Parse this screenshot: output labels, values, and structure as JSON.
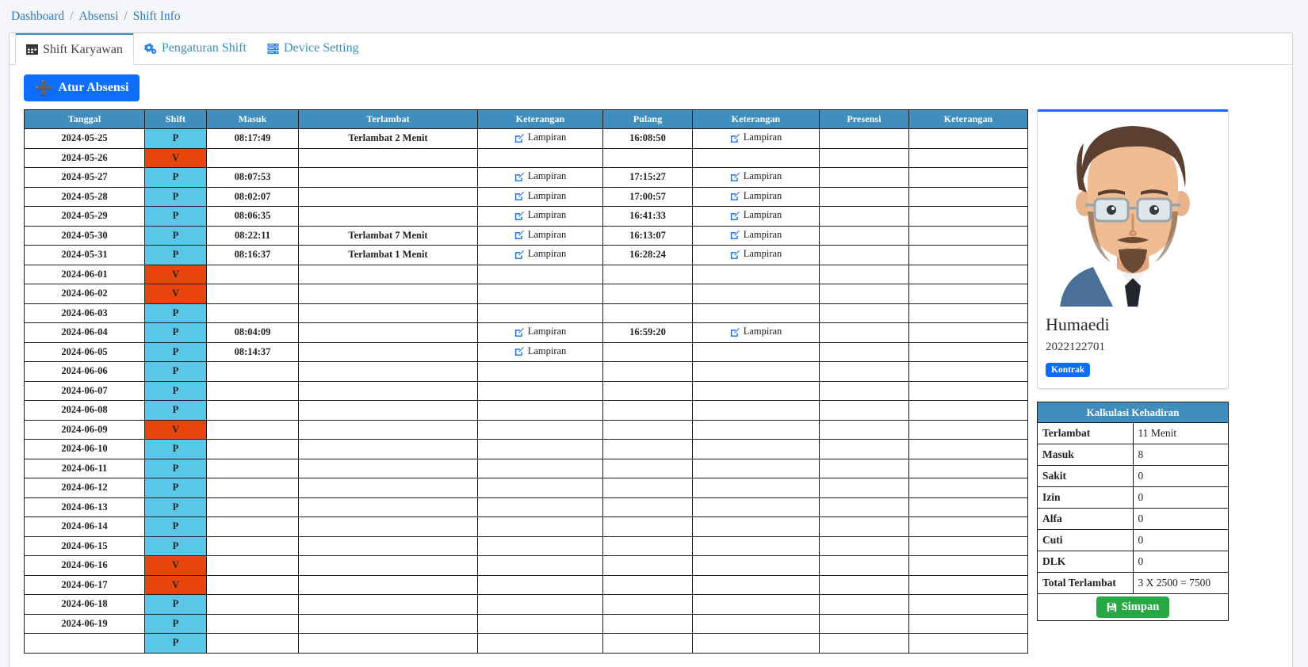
{
  "breadcrumb": {
    "items": [
      {
        "label": "Dashboard",
        "link": true
      },
      {
        "label": "Absensi",
        "link": true
      },
      {
        "label": "Shift Info",
        "link": true
      }
    ],
    "separator": "/"
  },
  "tabs": [
    {
      "label": "Shift Karyawan",
      "icon": "calendar-icon",
      "active": true
    },
    {
      "label": "Pengaturan Shift",
      "icon": "gears-icon",
      "active": false
    },
    {
      "label": "Device Setting",
      "icon": "server-icon",
      "active": false
    }
  ],
  "toolbar": {
    "add_button_label": "Atur Absensi",
    "add_button_icon": "plus-icon"
  },
  "table": {
    "columns": [
      "Tanggal",
      "Shift",
      "Masuk",
      "Terlambat",
      "Keterangan",
      "Pulang",
      "Keterangan",
      "Presensi",
      "Keterangan"
    ],
    "attachment_label": "Lampiran",
    "attachment_icon": "edit-square-icon",
    "rows": [
      {
        "tanggal": "2024-05-25",
        "shift": "P",
        "masuk": "08:17:49",
        "terlambat": "Terlambat 2 Menit",
        "ket1": "Lampiran",
        "pulang": "16:08:50",
        "ket2": "Lampiran",
        "presensi": "",
        "ket3": ""
      },
      {
        "tanggal": "2024-05-26",
        "shift": "V",
        "masuk": "",
        "terlambat": "",
        "ket1": "",
        "pulang": "",
        "ket2": "",
        "presensi": "",
        "ket3": ""
      },
      {
        "tanggal": "2024-05-27",
        "shift": "P",
        "masuk": "08:07:53",
        "terlambat": "",
        "ket1": "Lampiran",
        "pulang": "17:15:27",
        "ket2": "Lampiran",
        "presensi": "",
        "ket3": ""
      },
      {
        "tanggal": "2024-05-28",
        "shift": "P",
        "masuk": "08:02:07",
        "terlambat": "",
        "ket1": "Lampiran",
        "pulang": "17:00:57",
        "ket2": "Lampiran",
        "presensi": "",
        "ket3": ""
      },
      {
        "tanggal": "2024-05-29",
        "shift": "P",
        "masuk": "08:06:35",
        "terlambat": "",
        "ket1": "Lampiran",
        "pulang": "16:41:33",
        "ket2": "Lampiran",
        "presensi": "",
        "ket3": ""
      },
      {
        "tanggal": "2024-05-30",
        "shift": "P",
        "masuk": "08:22:11",
        "terlambat": "Terlambat 7 Menit",
        "ket1": "Lampiran",
        "pulang": "16:13:07",
        "ket2": "Lampiran",
        "presensi": "",
        "ket3": ""
      },
      {
        "tanggal": "2024-05-31",
        "shift": "P",
        "masuk": "08:16:37",
        "terlambat": "Terlambat 1 Menit",
        "ket1": "Lampiran",
        "pulang": "16:28:24",
        "ket2": "Lampiran",
        "presensi": "",
        "ket3": ""
      },
      {
        "tanggal": "2024-06-01",
        "shift": "V",
        "masuk": "",
        "terlambat": "",
        "ket1": "",
        "pulang": "",
        "ket2": "",
        "presensi": "",
        "ket3": ""
      },
      {
        "tanggal": "2024-06-02",
        "shift": "V",
        "masuk": "",
        "terlambat": "",
        "ket1": "",
        "pulang": "",
        "ket2": "",
        "presensi": "",
        "ket3": ""
      },
      {
        "tanggal": "2024-06-03",
        "shift": "P",
        "masuk": "",
        "terlambat": "",
        "ket1": "",
        "pulang": "",
        "ket2": "",
        "presensi": "",
        "ket3": ""
      },
      {
        "tanggal": "2024-06-04",
        "shift": "P",
        "masuk": "08:04:09",
        "terlambat": "",
        "ket1": "Lampiran",
        "pulang": "16:59:20",
        "ket2": "Lampiran",
        "presensi": "",
        "ket3": ""
      },
      {
        "tanggal": "2024-06-05",
        "shift": "P",
        "masuk": "08:14:37",
        "terlambat": "",
        "ket1": "Lampiran",
        "pulang": "",
        "ket2": "",
        "presensi": "",
        "ket3": ""
      },
      {
        "tanggal": "2024-06-06",
        "shift": "P",
        "masuk": "",
        "terlambat": "",
        "ket1": "",
        "pulang": "",
        "ket2": "",
        "presensi": "",
        "ket3": ""
      },
      {
        "tanggal": "2024-06-07",
        "shift": "P",
        "masuk": "",
        "terlambat": "",
        "ket1": "",
        "pulang": "",
        "ket2": "",
        "presensi": "",
        "ket3": ""
      },
      {
        "tanggal": "2024-06-08",
        "shift": "P",
        "masuk": "",
        "terlambat": "",
        "ket1": "",
        "pulang": "",
        "ket2": "",
        "presensi": "",
        "ket3": ""
      },
      {
        "tanggal": "2024-06-09",
        "shift": "V",
        "masuk": "",
        "terlambat": "",
        "ket1": "",
        "pulang": "",
        "ket2": "",
        "presensi": "",
        "ket3": ""
      },
      {
        "tanggal": "2024-06-10",
        "shift": "P",
        "masuk": "",
        "terlambat": "",
        "ket1": "",
        "pulang": "",
        "ket2": "",
        "presensi": "",
        "ket3": ""
      },
      {
        "tanggal": "2024-06-11",
        "shift": "P",
        "masuk": "",
        "terlambat": "",
        "ket1": "",
        "pulang": "",
        "ket2": "",
        "presensi": "",
        "ket3": ""
      },
      {
        "tanggal": "2024-06-12",
        "shift": "P",
        "masuk": "",
        "terlambat": "",
        "ket1": "",
        "pulang": "",
        "ket2": "",
        "presensi": "",
        "ket3": ""
      },
      {
        "tanggal": "2024-06-13",
        "shift": "P",
        "masuk": "",
        "terlambat": "",
        "ket1": "",
        "pulang": "",
        "ket2": "",
        "presensi": "",
        "ket3": ""
      },
      {
        "tanggal": "2024-06-14",
        "shift": "P",
        "masuk": "",
        "terlambat": "",
        "ket1": "",
        "pulang": "",
        "ket2": "",
        "presensi": "",
        "ket3": ""
      },
      {
        "tanggal": "2024-06-15",
        "shift": "P",
        "masuk": "",
        "terlambat": "",
        "ket1": "",
        "pulang": "",
        "ket2": "",
        "presensi": "",
        "ket3": ""
      },
      {
        "tanggal": "2024-06-16",
        "shift": "V",
        "masuk": "",
        "terlambat": "",
        "ket1": "",
        "pulang": "",
        "ket2": "",
        "presensi": "",
        "ket3": ""
      },
      {
        "tanggal": "2024-06-17",
        "shift": "V",
        "masuk": "",
        "terlambat": "",
        "ket1": "",
        "pulang": "",
        "ket2": "",
        "presensi": "",
        "ket3": ""
      },
      {
        "tanggal": "2024-06-18",
        "shift": "P",
        "masuk": "",
        "terlambat": "",
        "ket1": "",
        "pulang": "",
        "ket2": "",
        "presensi": "",
        "ket3": ""
      },
      {
        "tanggal": "2024-06-19",
        "shift": "P",
        "masuk": "",
        "terlambat": "",
        "ket1": "",
        "pulang": "",
        "ket2": "",
        "presensi": "",
        "ket3": ""
      },
      {
        "tanggal": "",
        "shift": "P",
        "masuk": "",
        "terlambat": "",
        "ket1": "",
        "pulang": "",
        "ket2": "",
        "presensi": "",
        "ket3": ""
      }
    ]
  },
  "profile": {
    "name": "Humaedi",
    "nip": "2022122701",
    "status_badge": "Kontrak",
    "avatar_icon": "user-avatar-illustration"
  },
  "kalkulasi": {
    "title": "Kalkulasi Kehadiran",
    "rows": [
      {
        "label": "Terlambat",
        "value": "11 Menit"
      },
      {
        "label": "Masuk",
        "value": "8"
      },
      {
        "label": "Sakit",
        "value": "0"
      },
      {
        "label": "Izin",
        "value": "0"
      },
      {
        "label": "Alfa",
        "value": "0"
      },
      {
        "label": "Cuti",
        "value": "0"
      },
      {
        "label": "DLK",
        "value": "0"
      },
      {
        "label": "Total Terlambat",
        "value": "3 X 2500  =  7500"
      }
    ],
    "save_button_label": "Simpan",
    "save_button_icon": "floppy-disk-icon"
  },
  "colors": {
    "header_blue": "#3f8ebd",
    "shift_p": "#5bc7e8",
    "shift_v": "#e8450d",
    "accent_blue": "#0d6efd",
    "late_red": "#ff0000",
    "save_green": "#28a745",
    "page_bg": "#f4f6f9"
  }
}
